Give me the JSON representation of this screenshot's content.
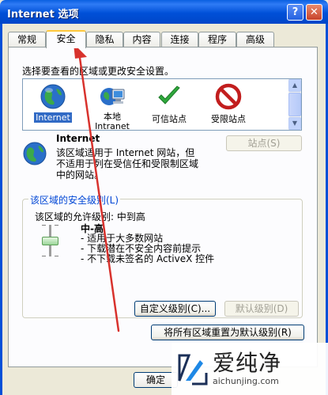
{
  "window": {
    "title": "Internet 选项",
    "help_label": "?",
    "close_label": "✕"
  },
  "tabs": [
    {
      "label": "常规"
    },
    {
      "label": "安全"
    },
    {
      "label": "隐私"
    },
    {
      "label": "内容"
    },
    {
      "label": "连接"
    },
    {
      "label": "程序"
    },
    {
      "label": "高级"
    }
  ],
  "active_tab": "安全",
  "security": {
    "instruction": "选择要查看的区域或更改安全设置。",
    "zones": [
      {
        "label": "Internet",
        "icon": "globe-icon",
        "selected": true
      },
      {
        "label": "本地 Intranet",
        "label_line1": "本地",
        "label_line2": "Intranet",
        "icon": "local-intranet-icon"
      },
      {
        "label": "可信站点",
        "icon": "check-icon"
      },
      {
        "label": "受限站点",
        "icon": "restricted-icon"
      }
    ],
    "selected_zone": {
      "name": "Internet",
      "description": "该区域适用于 Internet 网站，但不适用于列在受信任和受限制区域中的网站。",
      "desc_line1": "该区域适用于 Internet 网站，但",
      "desc_line2": "不适用于列在受信任和受限制区域",
      "desc_line3": "中的网站。",
      "sites_button": "站点(S)"
    },
    "level_group": {
      "legend": "该区域的安全级别(L)",
      "allowed": "该区域的允许级别: 中到高",
      "level_name": "中-高",
      "level_fraction": 0.5,
      "bullets": [
        "- 适用于大多数网站",
        "- 下载潜在不安全内容前提示",
        "- 不下载未签名的 ActiveX 控件"
      ],
      "custom_button": "自定义级别(C)...",
      "default_button": "默认级别(D)"
    },
    "reset_button": "将所有区域重置为默认级别(R)"
  },
  "footer": {
    "ok_button": "确定"
  },
  "watermark": {
    "text": "爱纯净",
    "url": "aichunjing.com"
  },
  "colors": {
    "title_bar": "#0050D8",
    "active_tab_highlight": "#FFC83C",
    "selection": "#316AC5",
    "group_legend": "#0046D5",
    "arrow": "#D8322D"
  }
}
